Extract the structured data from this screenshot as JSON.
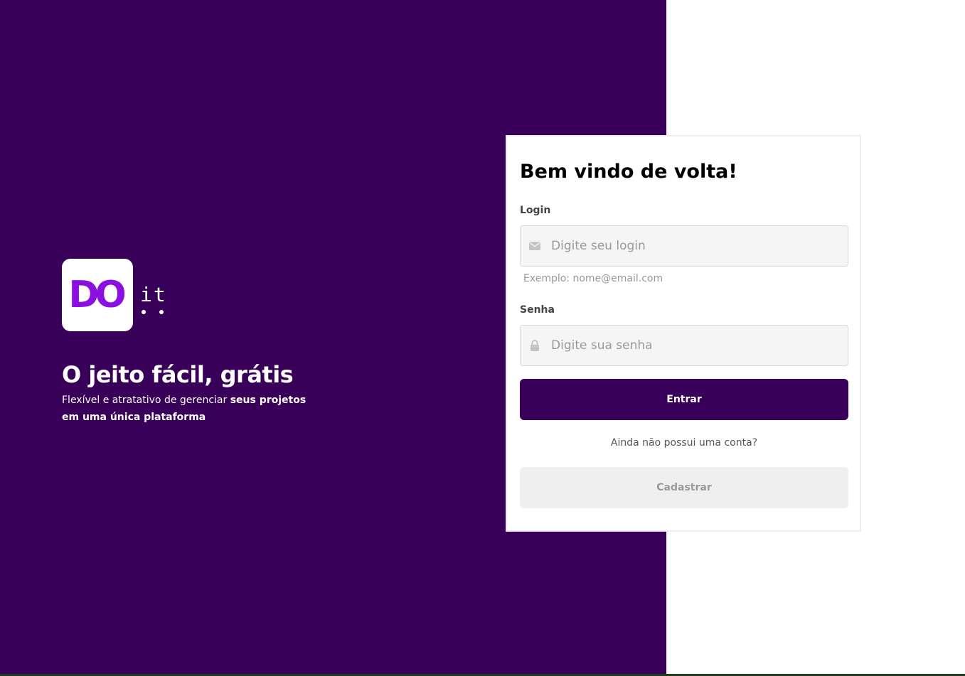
{
  "brand": {
    "logo_main": "DO",
    "logo_suffix": "it"
  },
  "hero": {
    "title": "O jeito fácil, grátis",
    "subtitle_plain": "Flexível e atratativo de gerenciar ",
    "subtitle_bold": "seus projetos em uma única plataforma"
  },
  "login_card": {
    "title": "Bem vindo de volta!",
    "login_label": "Login",
    "login_placeholder": "Digite seu login",
    "login_helper": "Exemplo: nome@email.com",
    "password_label": "Senha",
    "password_placeholder": "Digite sua senha",
    "submit_label": "Entrar",
    "signup_question": "Ainda não possui uma conta?",
    "signup_label": "Cadastrar"
  },
  "icons": {
    "login_icon": "envelope-icon",
    "password_icon": "lock-icon"
  },
  "colors": {
    "brand_purple": "#380058",
    "logo_purple": "#8a0fe0",
    "background": "#ffffff"
  }
}
